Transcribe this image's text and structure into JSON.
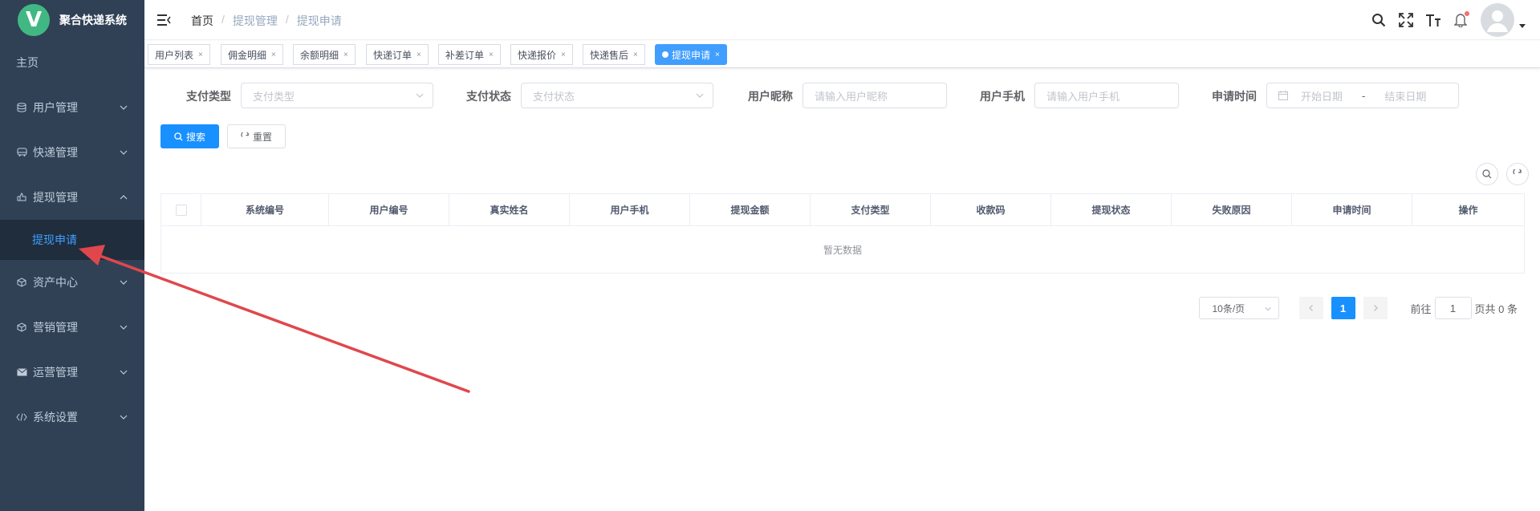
{
  "brand": {
    "logo_letter": "V",
    "title": "聚合快递系统"
  },
  "sidebar": {
    "home": "主页",
    "items": [
      {
        "label": "用户管理",
        "icon": "database-icon"
      },
      {
        "label": "快递管理",
        "icon": "bus-icon"
      },
      {
        "label": "提现管理",
        "icon": "withdraw-icon",
        "expanded": true
      },
      {
        "label": "资产中心",
        "icon": "box-icon"
      },
      {
        "label": "营销管理",
        "icon": "box-icon"
      },
      {
        "label": "运营管理",
        "icon": "mail-icon"
      },
      {
        "label": "系统设置",
        "icon": "code-icon"
      }
    ],
    "sub_active": "提现申请"
  },
  "breadcrumb": {
    "first": "首页",
    "second": "提现管理",
    "third": "提现申请",
    "sep": "/"
  },
  "tags": [
    {
      "label": "用户列表"
    },
    {
      "label": "佣金明细"
    },
    {
      "label": "余额明细"
    },
    {
      "label": "快递订单"
    },
    {
      "label": "补差订单"
    },
    {
      "label": "快递报价"
    },
    {
      "label": "快递售后"
    },
    {
      "label": "提现申请",
      "active": true
    }
  ],
  "filters": {
    "pay_type_label": "支付类型",
    "pay_type_placeholder": "支付类型",
    "pay_status_label": "支付状态",
    "pay_status_placeholder": "支付状态",
    "nickname_label": "用户昵称",
    "nickname_placeholder": "请输入用户昵称",
    "phone_label": "用户手机",
    "phone_placeholder": "请输入用户手机",
    "time_label": "申请时间",
    "start_placeholder": "开始日期",
    "range_sep": "-",
    "end_placeholder": "结束日期"
  },
  "buttons": {
    "search": "搜索",
    "reset": "重置"
  },
  "table": {
    "columns": [
      "系统编号",
      "用户编号",
      "真实姓名",
      "用户手机",
      "提现金额",
      "支付类型",
      "收款码",
      "提现状态",
      "失败原因",
      "申请时间",
      "操作"
    ],
    "empty_text": "暂无数据"
  },
  "pagination": {
    "page_size": "10条/页",
    "current_page": "1",
    "goto_label": "前往",
    "goto_value": "1",
    "page_suffix": "页",
    "total_text": "共 0 条"
  },
  "colors": {
    "sidebar_bg": "#304156",
    "active_blue": "#409eff",
    "primary": "#1890ff",
    "annotation_arrow": "#e0474c"
  }
}
